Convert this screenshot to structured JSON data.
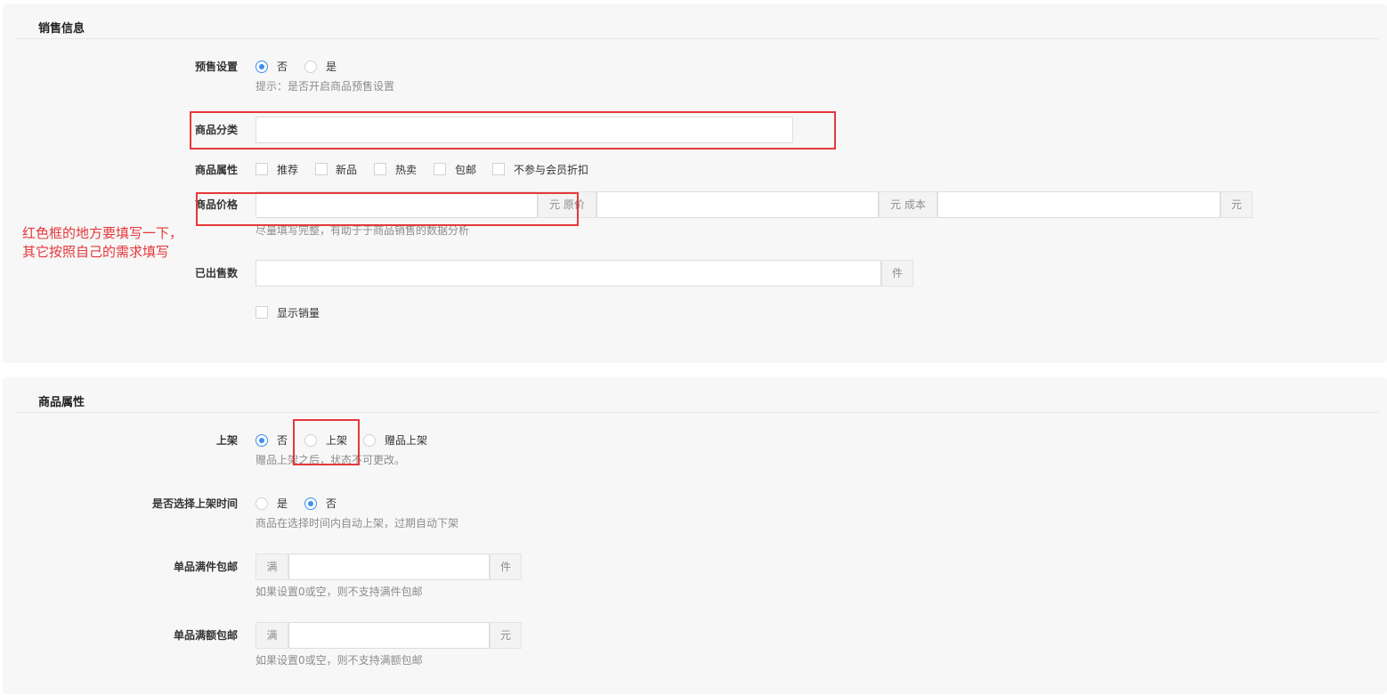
{
  "sales_info": {
    "title": "销售信息",
    "presale": {
      "label": "预售设置",
      "options": [
        "否",
        "是"
      ],
      "selected": "否",
      "hint": "提示：是否开启商品预售设置"
    },
    "category": {
      "label": "商品分类",
      "value": ""
    },
    "attributes": {
      "label": "商品属性",
      "options": [
        "推荐",
        "新品",
        "热卖",
        "包邮",
        "不参与会员折扣"
      ]
    },
    "price": {
      "label": "商品价格",
      "price_unit": "元 原价",
      "original_unit": "元 成本",
      "cost_unit": "元",
      "hint": "尽量填写完整，有助于于商品销售的数据分析"
    },
    "sold": {
      "label": "已出售数",
      "unit": "件"
    },
    "show_sales": {
      "label": "显示销量"
    }
  },
  "product_attrs": {
    "title": "商品属性",
    "listing": {
      "label": "上架",
      "options": [
        "否",
        "上架",
        "赠品上架"
      ],
      "selected": "否",
      "hint": "赠品上架之后，状态不可更改。"
    },
    "schedule": {
      "label": "是否选择上架时间",
      "options": [
        "是",
        "否"
      ],
      "selected": "否",
      "hint": "商品在选择时间内自动上架，过期自动下架"
    },
    "free_ship_qty": {
      "label": "单品满件包邮",
      "prefix": "满",
      "suffix": "件",
      "hint": "如果设置0或空，则不支持满件包邮"
    },
    "free_ship_amount": {
      "label": "单品满额包邮",
      "prefix": "满",
      "suffix": "元",
      "hint": "如果设置0或空，则不支持满额包邮"
    }
  },
  "annotation": {
    "line1": "红色框的地方要填写一下，",
    "line2": "其它按照自己的需求填写"
  },
  "colors": {
    "accent": "#3b8ff1",
    "annotation_red": "#e5383b",
    "panel_bg": "#f7f7f7"
  }
}
